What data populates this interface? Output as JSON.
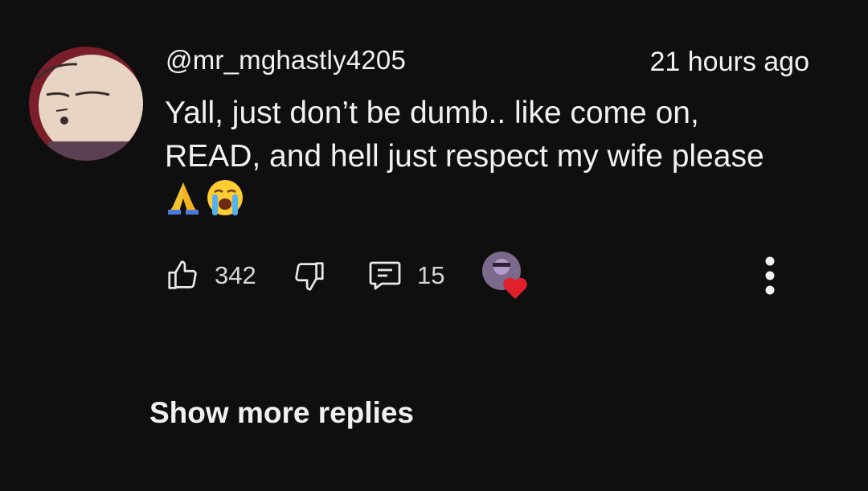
{
  "comment": {
    "author": "@mr_mghastly4205",
    "timestamp": "21 hours ago",
    "text_line1": "Yall, just don’t be dumb.. like come on,",
    "text_line2": "READ, and hell just respect my wife please",
    "emoji": [
      "folded-hands",
      "loudly-crying-face"
    ]
  },
  "actions": {
    "like_count": "342",
    "reply_count": "15",
    "creator_heart": true
  },
  "footer": {
    "show_more_label": "Show more replies"
  },
  "colors": {
    "background": "#0f0f10",
    "text": "#f1f1f1",
    "heart": "#e0202b"
  },
  "icons": [
    "thumb-up-icon",
    "thumb-down-icon",
    "comment-icon",
    "creator-heart-icon",
    "more-vertical-icon"
  ]
}
